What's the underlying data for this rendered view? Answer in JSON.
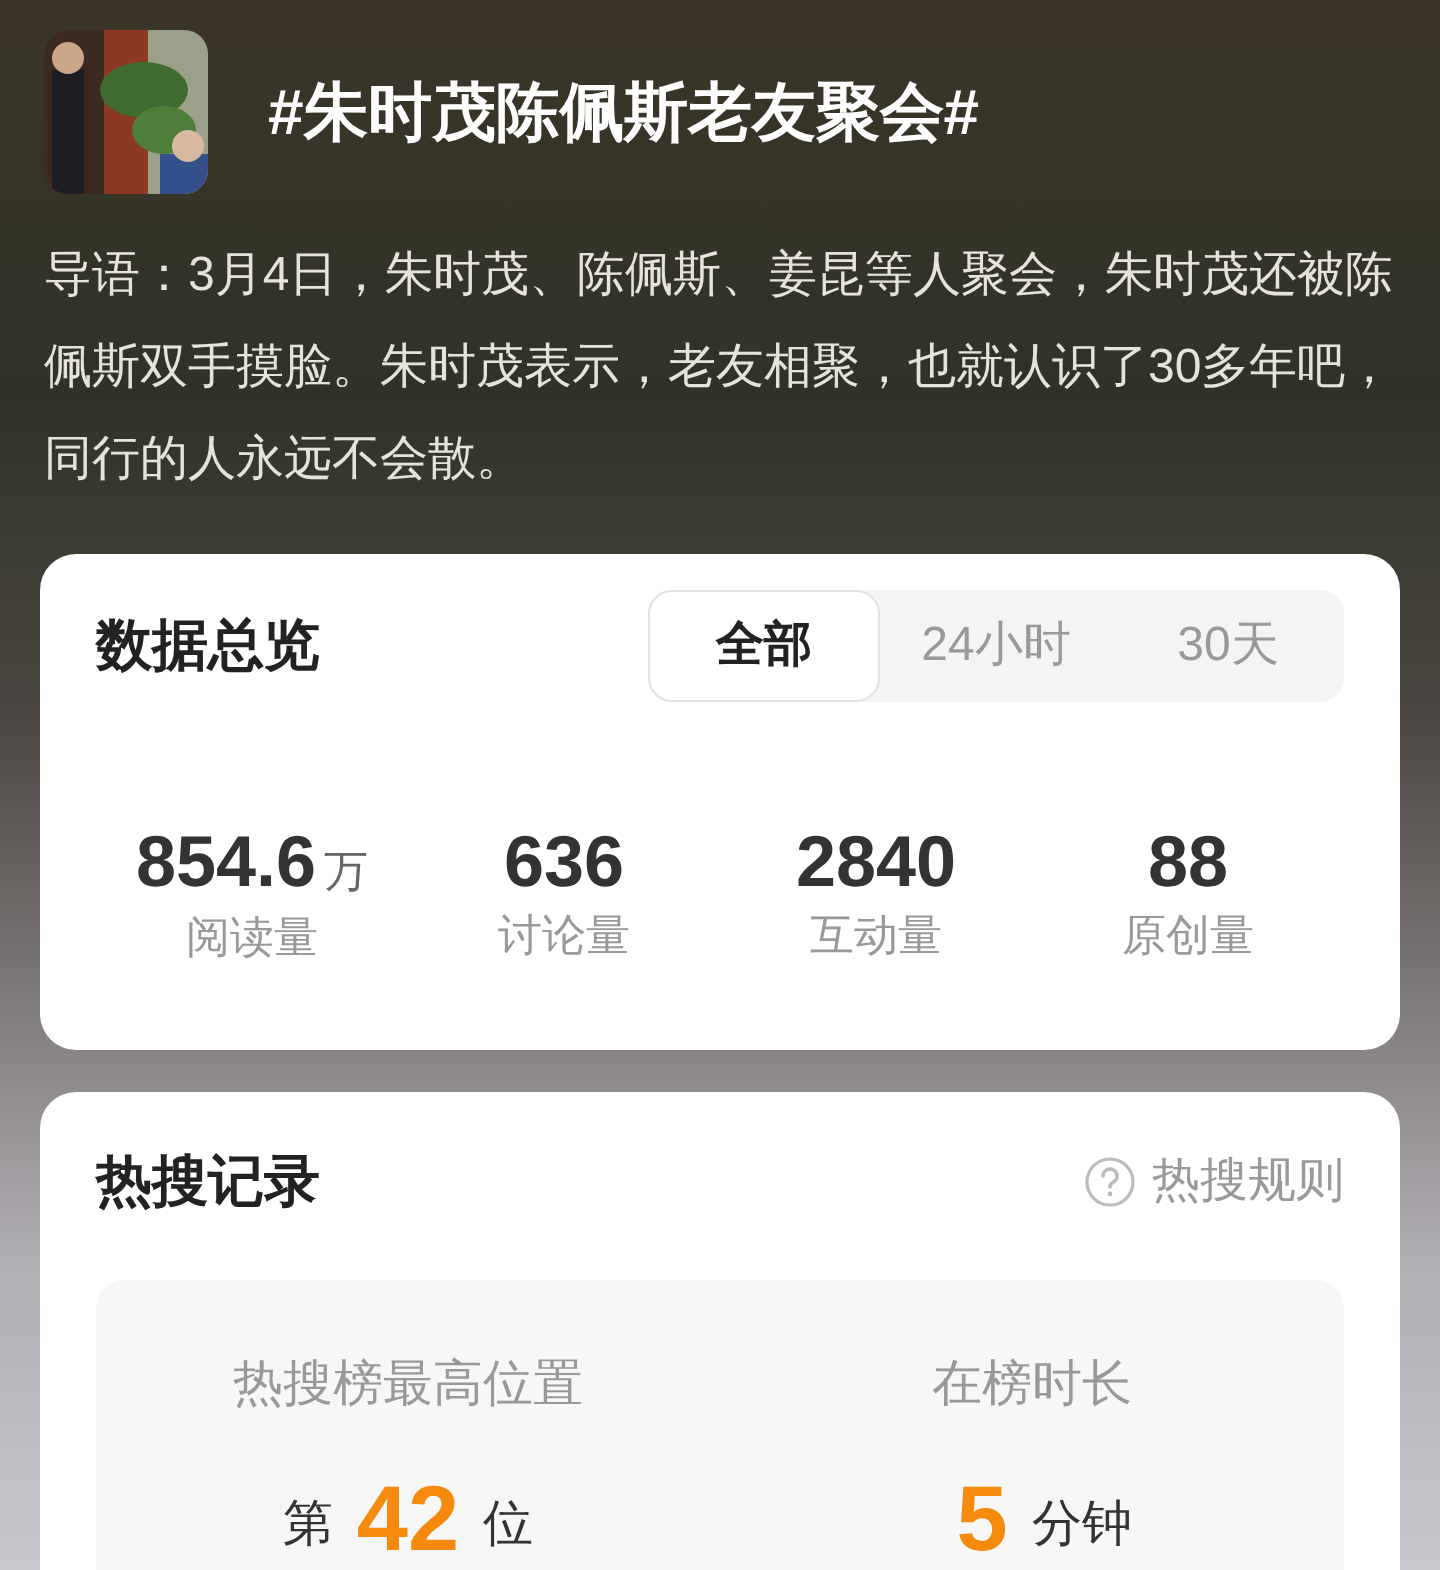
{
  "topic": {
    "title": "#朱时茂陈佩斯老友聚会#",
    "intro": "导语：3月4日，朱时茂、陈佩斯、姜昆等人聚会，朱时茂还被陈佩斯双手摸脸。朱时茂表示，老友相聚，也就认识了30多年吧，同行的人永远不会散。"
  },
  "overview": {
    "title": "数据总览",
    "tabs": [
      {
        "label": "全部",
        "selected": true
      },
      {
        "label": "24小时",
        "selected": false
      },
      {
        "label": "30天",
        "selected": false
      }
    ],
    "stats": [
      {
        "value": "854.6",
        "unit": "万",
        "label": "阅读量"
      },
      {
        "value": "636",
        "label": "讨论量"
      },
      {
        "value": "2840",
        "label": "互动量"
      },
      {
        "value": "88",
        "label": "原创量"
      }
    ]
  },
  "hot_search": {
    "title": "热搜记录",
    "rules_link": "热搜规则",
    "records": [
      {
        "label": "热搜榜最高位置",
        "prefix": "第",
        "value": "42",
        "suffix": "位"
      },
      {
        "label": "在榜时长",
        "value": "5",
        "suffix": "分钟"
      }
    ]
  }
}
